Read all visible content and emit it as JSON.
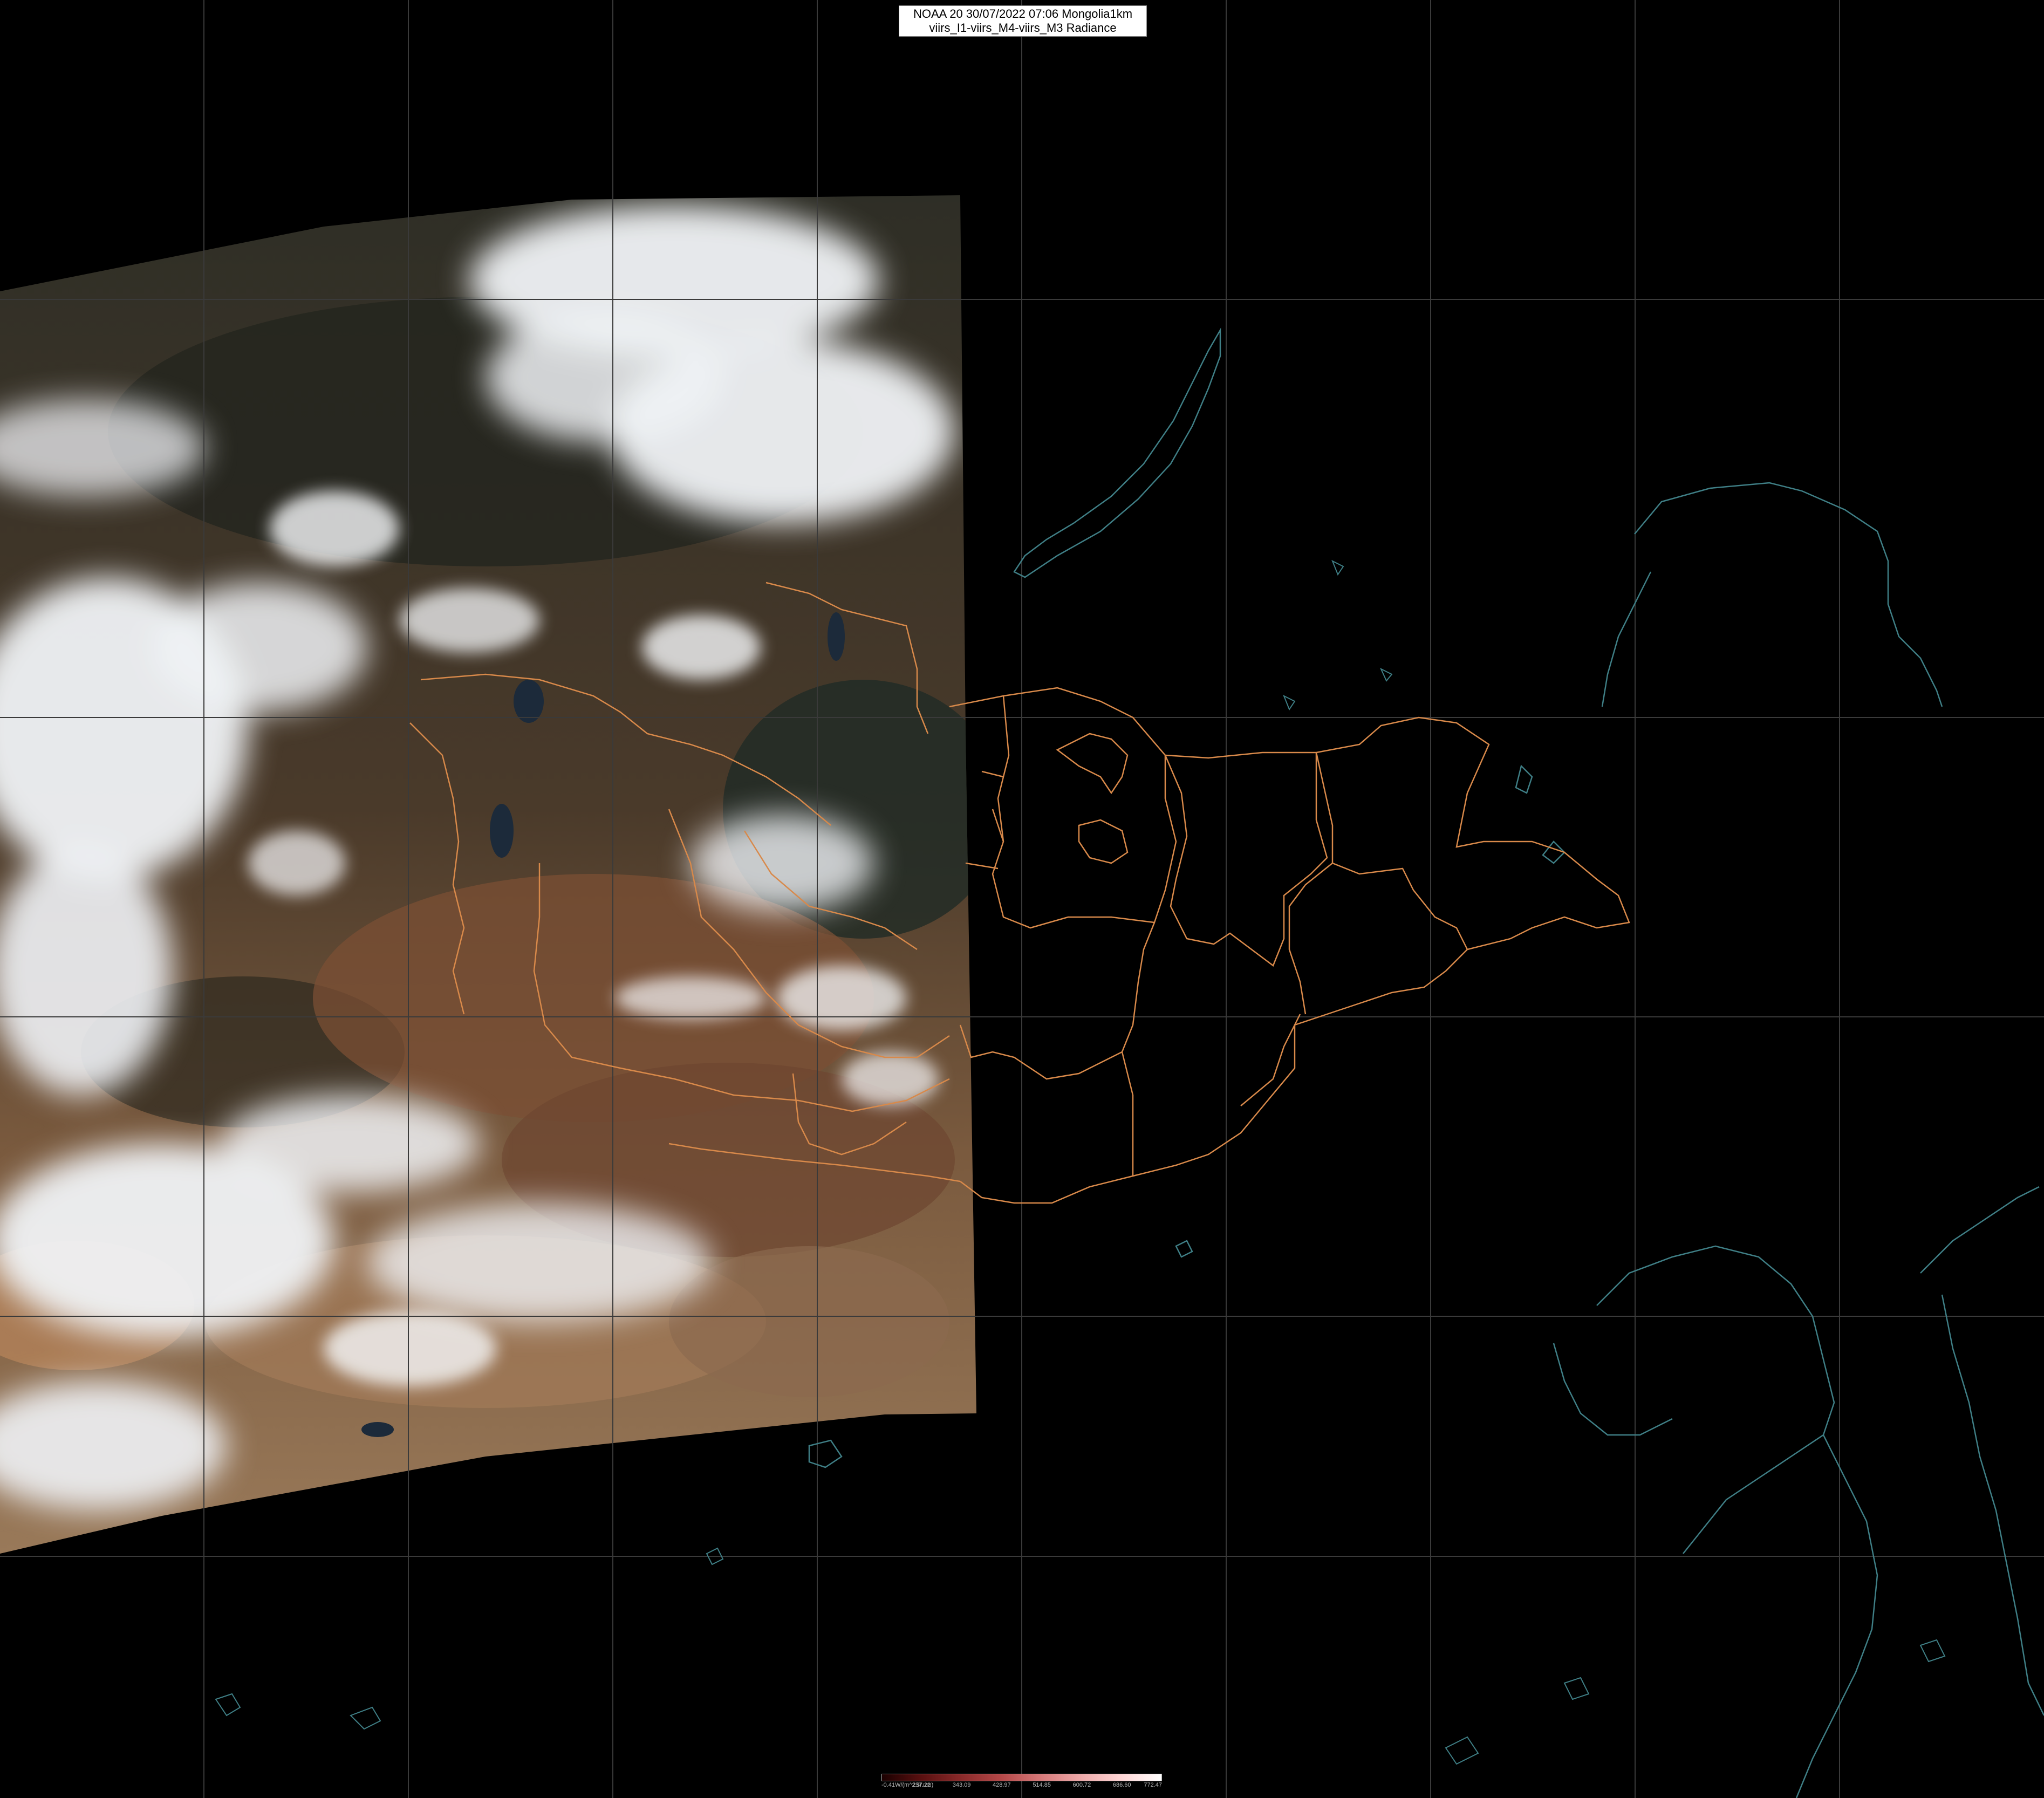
{
  "title": {
    "line1": "NOAA 20 30/07/2022 07:06 Mongolia1km",
    "line2": "viirs_I1-viirs_M4-viirs_M3 Radiance"
  },
  "colors": {
    "background": "#000000",
    "graticule": "#3a3a3a",
    "boundary_admin": "#d8894a",
    "coastline": "#3f7f86",
    "cloud": "#f2f4f8",
    "desert": "#9a6a4a",
    "land_dark": "#2a2a22"
  },
  "colorbar": {
    "labels": [
      "-0.41W/(m^2.sr.um)",
      "257.22",
      "343.09",
      "428.97",
      "514.85",
      "600.72",
      "686.60",
      "772.47"
    ],
    "gradient": [
      "#1a0000",
      "#5a1010",
      "#8a2a2a",
      "#b54848",
      "#d67a7a",
      "#eeaaaa",
      "#ffd6d6",
      "#ffffff"
    ]
  }
}
